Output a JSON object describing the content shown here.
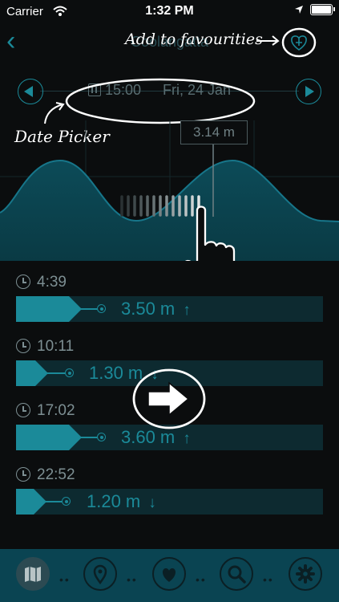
{
  "status": {
    "carrier": "Carrier",
    "time": "1:32 PM"
  },
  "nav": {
    "back_label": "‹",
    "title": "Coolangatta"
  },
  "annotations": {
    "favourites": "Add to favourities",
    "date_picker": "Date Picker"
  },
  "date": {
    "time": "15:00",
    "day": "Fri, 24 Jan"
  },
  "chart_data": {
    "type": "area",
    "x": [
      "4:39",
      "10:11",
      "17:02",
      "22:52"
    ],
    "values": [
      3.5,
      1.3,
      3.6,
      1.2
    ],
    "current_label": "3.14 m",
    "current_time": "15:00"
  },
  "tides": [
    {
      "time": "4:39",
      "height": "3.50 m",
      "dir": "↑",
      "level": 0.92
    },
    {
      "time": "10:11",
      "height": "1.30 m",
      "dir": "↓",
      "level": 0.34
    },
    {
      "time": "17:02",
      "height": "3.60 m",
      "dir": "↑",
      "level": 0.95
    },
    {
      "time": "22:52",
      "height": "1.20 m",
      "dir": "↓",
      "level": 0.31
    }
  ],
  "tabs": [
    "map-icon",
    "location-pin-icon",
    "heart-icon",
    "search-icon",
    "gear-icon"
  ],
  "colors": {
    "accent": "#1b8a99",
    "tabbar": "#0a4452",
    "background": "#0b0d0e"
  }
}
